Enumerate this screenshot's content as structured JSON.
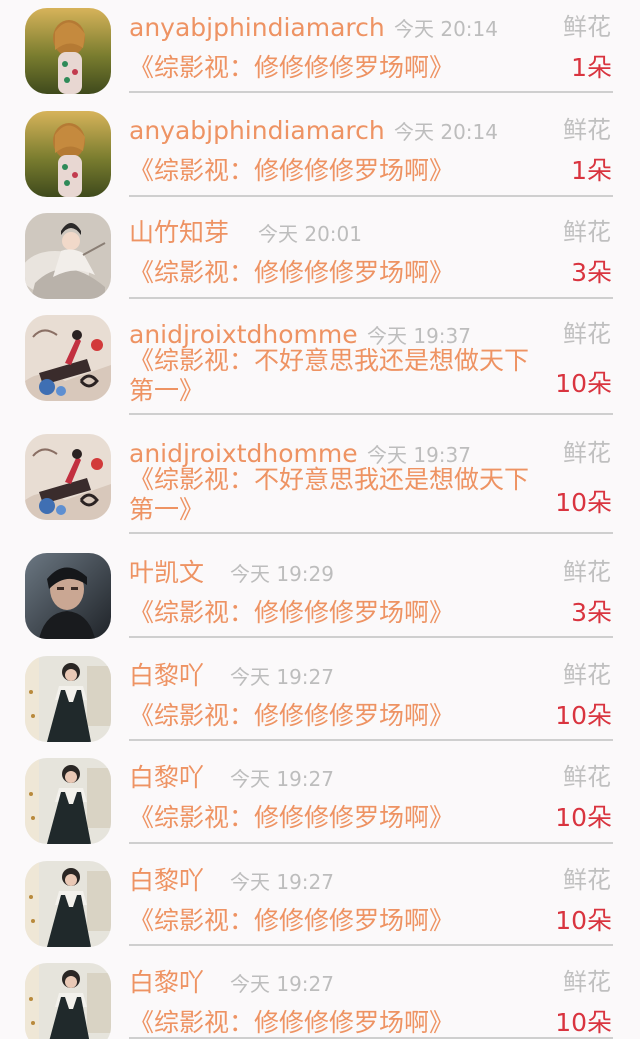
{
  "gift_label": "鲜花",
  "items": [
    {
      "name": "anyabjphindiamarch",
      "time": "今天 20:14",
      "title": "《综影视：修修修修罗场啊》",
      "count": "1朵",
      "avatar": "girl-in-field-avatar"
    },
    {
      "name": "anyabjphindiamarch",
      "time": "今天 20:14",
      "title": "《综影视：修修修修罗场啊》",
      "count": "1朵",
      "avatar": "girl-in-field-avatar"
    },
    {
      "name": "山竹知芽",
      "time": "今天 20:01",
      "title": "《综影视：修修修修罗场啊》",
      "count": "3朵",
      "avatar": "ancient-costume-avatar"
    },
    {
      "name": "anidjroixtdhomme",
      "time": "今天 19:37",
      "title": "《综影视：不好意思我还是想做天下第一》",
      "count": "10朵",
      "avatar": "illustration-avatar"
    },
    {
      "name": "anidjroixtdhomme",
      "time": "今天 19:37",
      "title": "《综影视：不好意思我还是想做天下第一》",
      "count": "10朵",
      "avatar": "illustration-avatar"
    },
    {
      "name": "叶凯文",
      "time": "今天 19:29",
      "title": "《综影视：修修修修罗场啊》",
      "count": "3朵",
      "avatar": "young-man-avatar"
    },
    {
      "name": "白黎吖",
      "time": "今天 19:27",
      "title": "《综影视：修修修修罗场啊》",
      "count": "10朵",
      "avatar": "girl-in-dress-avatar"
    },
    {
      "name": "白黎吖",
      "time": "今天 19:27",
      "title": "《综影视：修修修修罗场啊》",
      "count": "10朵",
      "avatar": "girl-in-dress-avatar"
    },
    {
      "name": "白黎吖",
      "time": "今天 19:27",
      "title": "《综影视：修修修修罗场啊》",
      "count": "10朵",
      "avatar": "girl-in-dress-avatar"
    },
    {
      "name": "白黎吖",
      "time": "今天 19:27",
      "title": "《综影视：修修修修罗场啊》",
      "count": "10朵",
      "avatar": "girl-in-dress-avatar"
    }
  ]
}
